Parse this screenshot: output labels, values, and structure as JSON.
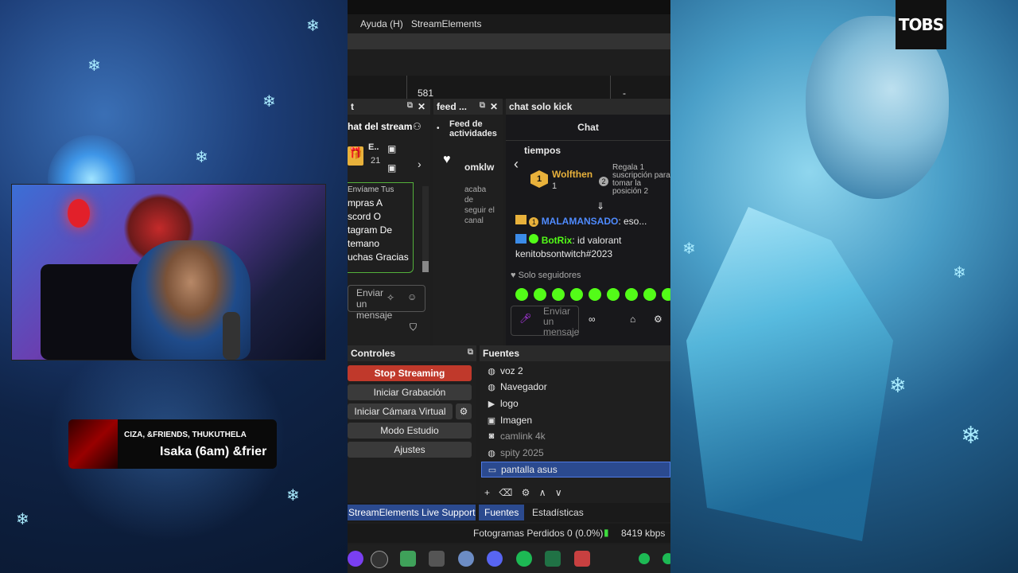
{
  "menu": {
    "items": [
      "Ayuda (H)",
      "StreamElements"
    ]
  },
  "stats": {
    "value": "581",
    "dash": "-"
  },
  "dock_chat": {
    "title": "t",
    "header": "hat del stream",
    "gift_name": "E..",
    "gift_count": "21",
    "messages": [
      "Envíame Tus",
      "mpras A",
      "scord O",
      "tagram De",
      "temano",
      "uchas Gracias"
    ],
    "input_placeholder": "Enviar un mensaje"
  },
  "dock_feed": {
    "title": "feed ...",
    "header": "Feed de actividades",
    "user": "omklw",
    "action": "acaba de seguir el canal"
  },
  "dock_kick": {
    "title": "chat solo kick",
    "header": "Chat",
    "snippet": "tiempos",
    "gifter_name": "Wolfthen",
    "gifter_rank": "1",
    "gifter_count": "1",
    "gift_text": "Regala 1 suscripción para tomar la posición 2",
    "rank2": "2",
    "msg1_user": "MALAMANSADO",
    "msg1_text": ": eso...",
    "msg1_badge": "1",
    "msg2_user": "BotRix",
    "msg2_text": ": id valorant kenitobsontwitch#2023",
    "followers_only": "Solo seguidores",
    "input_placeholder": "Enviar un mensaje"
  },
  "controls": {
    "title": "Controles",
    "buttons": [
      "Stop Streaming",
      "Iniciar Grabación",
      "Iniciar Cámara Virtual",
      "Modo Estudio",
      "Ajustes"
    ]
  },
  "sources": {
    "title": "Fuentes",
    "items": [
      {
        "icon": "globe",
        "label": "voz 2"
      },
      {
        "icon": "globe",
        "label": "Navegador"
      },
      {
        "icon": "play",
        "label": "logo"
      },
      {
        "icon": "image",
        "label": "Imagen"
      },
      {
        "icon": "camera",
        "label": "camlink 4k"
      },
      {
        "icon": "globe",
        "label": "spity 2025"
      },
      {
        "icon": "monitor",
        "label": "pantalla asus"
      }
    ]
  },
  "tabs": {
    "support": "StreamElements Live Support",
    "fuentes": "Fuentes",
    "estadisticas": "Estadísticas"
  },
  "status": {
    "dropped": "Fotogramas Perdidos 0 (0.0%)",
    "bitrate": "8419 kbps"
  },
  "now_playing": {
    "artists": "CIZA, &FRIENDS, THUKUTHELA",
    "title": "Isaka (6am) &frier"
  },
  "watermark": {
    "text": "TOBS"
  },
  "colors": {
    "stop": "#c0392b",
    "kick_green": "#53fc18",
    "selection": "#2b4a8f",
    "tab_active": "#2b4a8f"
  }
}
